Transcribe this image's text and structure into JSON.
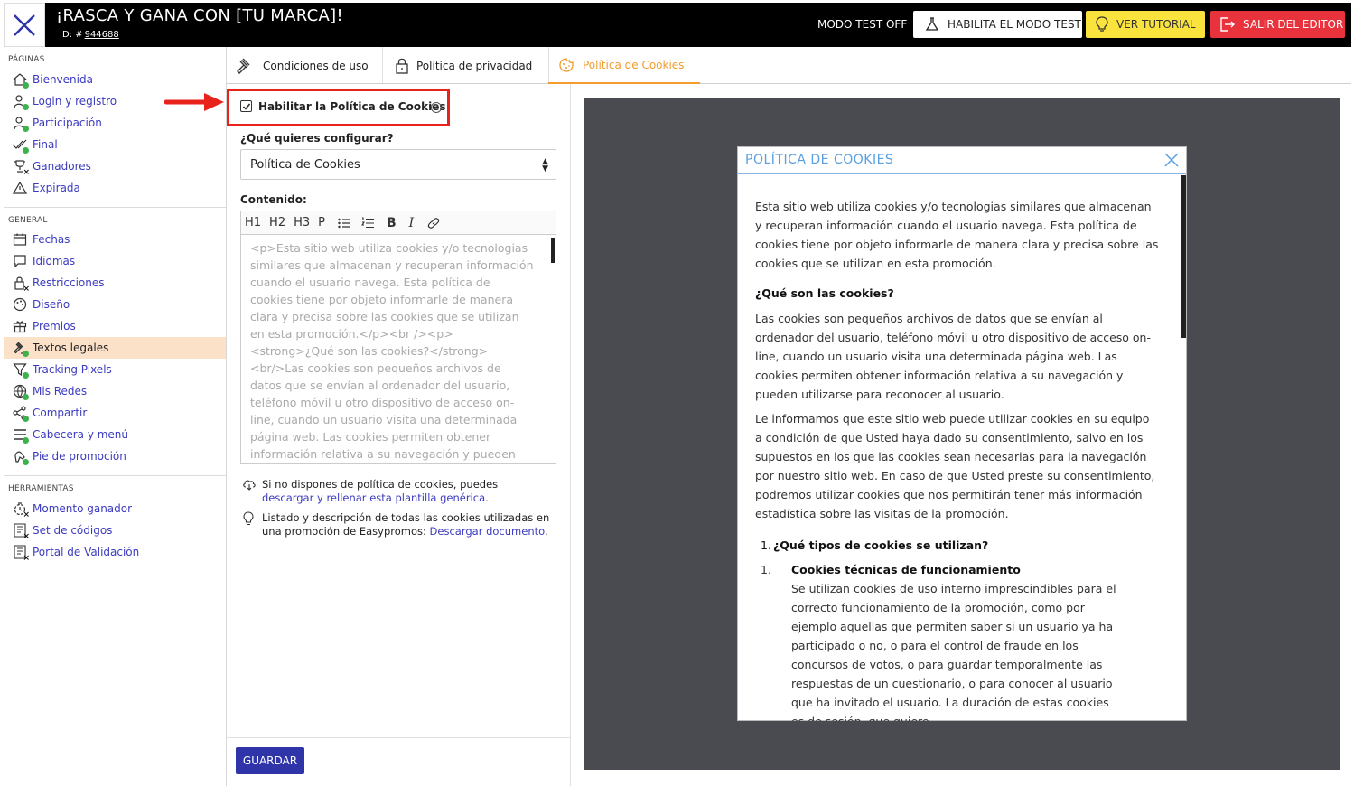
{
  "header": {
    "title": "¡RASCA Y GANA CON [TU MARCA]!",
    "id_label": "ID: #",
    "id_value": "944688",
    "mode_status": "MODO TEST OFF",
    "btn_test": "HABILITA EL MODO TEST",
    "btn_tutorial": "VER TUTORIAL",
    "btn_exit": "SALIR DEL EDITOR"
  },
  "sidebar": {
    "sec_pages": "PÁGINAS",
    "sec_general": "GENERAL",
    "sec_tools": "HERRAMIENTAS",
    "pages": [
      "Bienvenida",
      "Login y registro",
      "Participación",
      "Final",
      "Ganadores",
      "Expirada"
    ],
    "general": [
      "Fechas",
      "Idiomas",
      "Restricciones",
      "Diseño",
      "Premios",
      "Textos legales",
      "Tracking Pixels",
      "Mis Redes",
      "Compartir",
      "Cabecera y menú",
      "Pie de promoción"
    ],
    "tools": [
      "Momento ganador",
      "Set de códigos",
      "Portal de Validación"
    ],
    "active": "Textos legales"
  },
  "tabs": {
    "terms": "Condiciones de uso",
    "privacy": "Política de privacidad",
    "cookies": "Política de Cookies"
  },
  "editor": {
    "enable_label": "Habilitar la Política de Cookies",
    "enable_checked": true,
    "help_glyph": "?",
    "config_question": "¿Qué quieres configurar?",
    "config_value": "Política de Cookies",
    "content_label": "Contenido:",
    "toolbar": [
      "H1",
      "H2",
      "H3",
      "P"
    ],
    "content_text": "<p>Esta sitio web utiliza cookies y/o tecnologias similares que almacenan y recuperan información cuando el usuario navega. Esta política de cookies tiene por objeto informarle de manera clara y precisa sobre las cookies que se utilizan en esta promoción.</p><br /><p><strong>¿Qué son las cookies?</strong><br/>Las cookies son pequeños archivos de datos que se envían al ordenador del usuario, teléfono móvil u otro dispositivo de acceso on-line, cuando un usuario visita una determinada página web. Las cookies permiten obtener información relativa a su navegación y pueden utilizarse para reconocer al usuario.</p><p>Le",
    "hint1_text": "Si no dispones de política de cookies, puedes",
    "hint1_link": "descargar y rellenar esta plantilla genérica",
    "hint1_end": ".",
    "hint2_text": "Listado y descripción de todas las cookies utilizadas en una promoción de Easypromos:",
    "hint2_link": "Descargar documento",
    "hint2_end": ".",
    "save": "GUARDAR"
  },
  "preview": {
    "title": "POLÍTICA DE COOKIES",
    "p1": "Esta sitio web utiliza cookies y/o tecnologias similares que almacenan y recuperan información cuando el usuario navega. Esta política de cookies tiene por objeto informarle de manera clara y precisa sobre las cookies que se utilizan en esta promoción.",
    "h1": "¿Qué son las cookies?",
    "p2": "Las cookies son pequeños archivos de datos que se envían al ordenador del usuario, teléfono móvil u otro dispositivo de acceso on-line, cuando un usuario visita una determinada página web. Las cookies permiten obtener información relativa a su navegación y pueden utilizarse para reconocer al usuario.",
    "p3": "Le informamos que este sitio web puede utilizar cookies en su equipo a condición de que Usted haya dado su consentimiento, salvo en los supuestos en los que las cookies sean necesarias para la navegación por nuestro sitio web. En caso de que Usted preste su consentimiento, podremos utilizar cookies que nos permitirán tener más información estadística sobre las visitas de la promoción.",
    "list_num1": "1.",
    "list_item1": "¿Qué tipos de cookies se utilizan?",
    "sub_num1": "1.",
    "sub_title1": "Cookies técnicas de funcionamiento",
    "sub_text1": "Se utilizan cookies de uso interno imprescindibles para el correcto funcionamiento de la promoción, como por ejemplo aquellas que permiten saber si un usuario ya ha participado o no, o para el control de fraude en los concursos de votos, o para guardar temporalmente las respuestas de un cuestionario, o para conocer al usuario que ha invitado el usuario. La duración de estas cookies es de sesión, que quiere"
  },
  "colors": {
    "accent": "#f19c2f",
    "link": "#3b3bbf",
    "highlight": "#e8231c",
    "save": "#2f35a8",
    "tutorial": "#f9e33c",
    "exit": "#e8323c"
  }
}
